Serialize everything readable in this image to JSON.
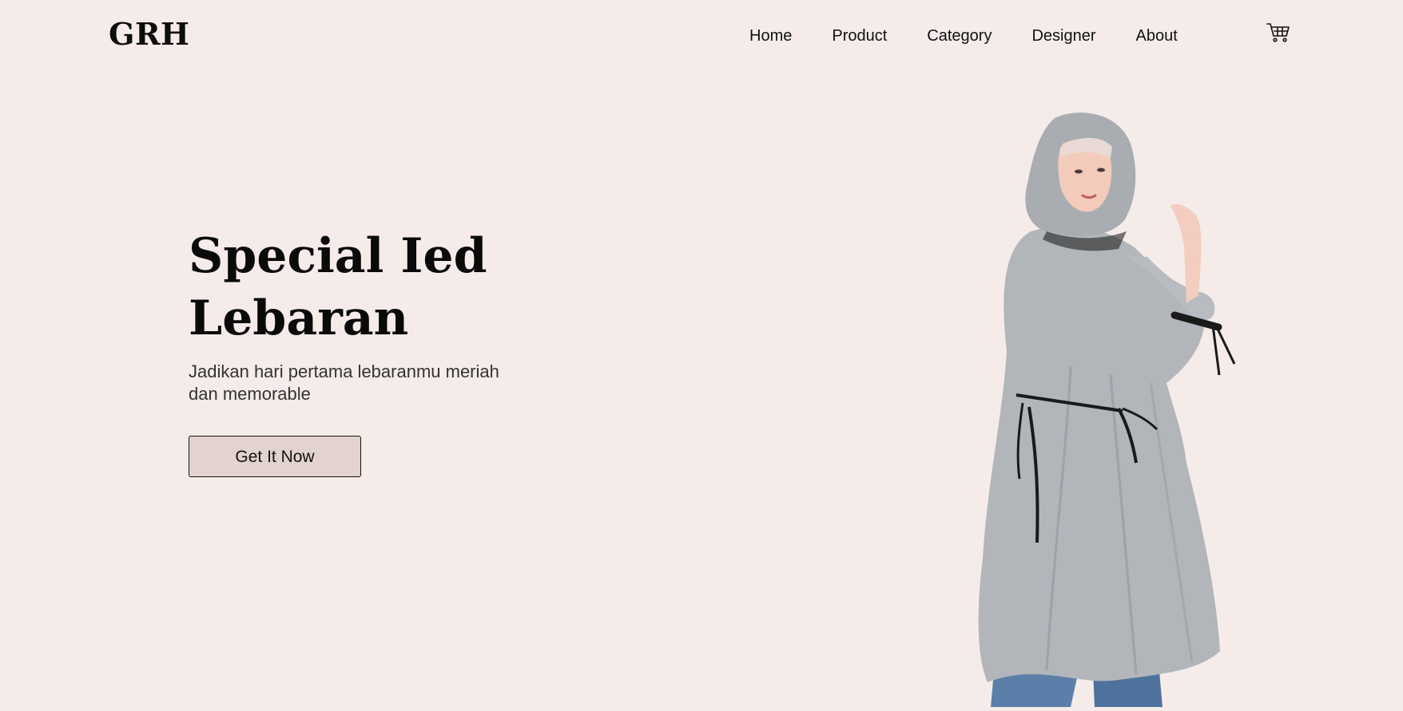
{
  "brand": {
    "logo_text": "GRH"
  },
  "nav": {
    "items": [
      {
        "label": "Home"
      },
      {
        "label": "Product"
      },
      {
        "label": "Category"
      },
      {
        "label": "Designer"
      },
      {
        "label": "About"
      }
    ],
    "cart_icon": "shopping-cart-icon"
  },
  "hero": {
    "title": "Special Ied Lebaran",
    "subtitle": "Jadikan hari pertama lebaranmu meriah dan memorable",
    "cta_label": "Get It Now",
    "image": "model-in-grey-hijab-dress"
  },
  "colors": {
    "background": "#f5ece9",
    "button": "#e2d3ce",
    "text": "#111111",
    "dress": "#b3b7bc"
  }
}
